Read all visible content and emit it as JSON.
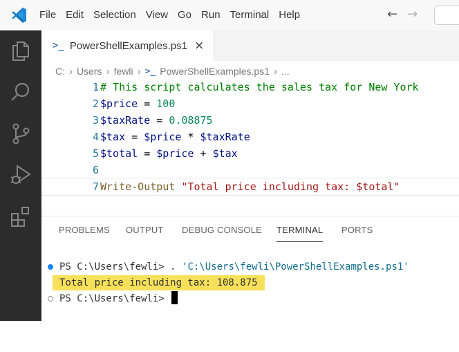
{
  "menubar": {
    "items": [
      "File",
      "Edit",
      "Selection",
      "View",
      "Go",
      "Run",
      "Terminal",
      "Help"
    ],
    "back_arrow": "←",
    "forward_arrow": "→"
  },
  "activitybar": {
    "icons": [
      "explorer-icon",
      "search-icon",
      "source-control-icon",
      "run-debug-icon",
      "extensions-icon"
    ]
  },
  "tab": {
    "icon_glyph": ">_",
    "label": "PowerShellExamples.ps1",
    "close": "×"
  },
  "breadcrumb": {
    "parts": [
      "C:",
      "Users",
      "fewli"
    ],
    "separator": "›",
    "file": "PowerShellExamples.ps1",
    "more": "..."
  },
  "code": {
    "line_numbers": [
      "1",
      "2",
      "3",
      "4",
      "5",
      "6",
      "7"
    ],
    "line1": "# This script calculates the sales tax for New York",
    "line2_var": "$price",
    "line2_op": " = ",
    "line2_num": "100",
    "line3_var": "$taxRate",
    "line3_op": " = ",
    "line3_num": "0.08875",
    "line4_var1": "$tax",
    "line4_op1": " = ",
    "line4_var2": "$price",
    "line4_op2": " * ",
    "line4_var3": "$taxRate",
    "line5_var1": "$total",
    "line5_op1": " = ",
    "line5_var2": "$price",
    "line5_op2": " + ",
    "line5_var3": "$tax",
    "line7_cmd": "Write-Output",
    "line7_str": " \"Total price including tax: $total\""
  },
  "panel": {
    "tabs": [
      "PROBLEMS",
      "OUTPUT",
      "DEBUG CONSOLE",
      "TERMINAL",
      "PORTS"
    ],
    "active_tab": "TERMINAL",
    "term1_prompt": "PS C:\\Users\\fewli> . ",
    "term1_path": "'C:\\Users\\fewli\\PowerShellExamples.ps1'",
    "term2_output": "Total price including tax: 108.875",
    "term3_prompt": "PS C:\\Users\\fewli> "
  },
  "colors": {
    "accent": "#007acc",
    "activitybar": "#2c2c2c",
    "highlight": "#f7e15a"
  }
}
